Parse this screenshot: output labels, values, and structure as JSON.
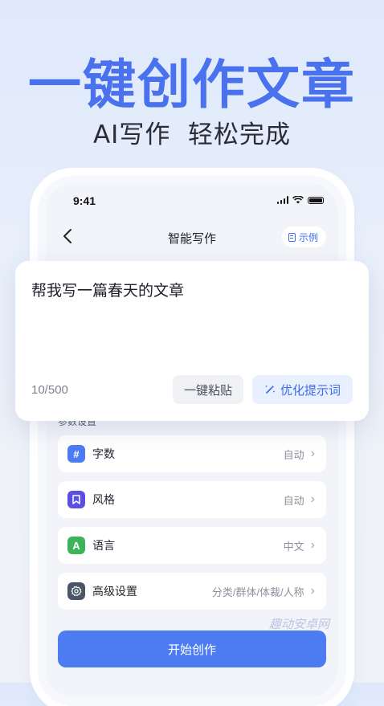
{
  "hero": {
    "title": "一键创作文章",
    "subtitle": "AI写作  轻松完成"
  },
  "status_bar": {
    "time": "9:41"
  },
  "nav": {
    "title": "智能写作",
    "example_label": "示例"
  },
  "editor": {
    "prompt": "帮我写一篇春天的文章",
    "char_count": "10/500",
    "paste_label": "一键粘贴",
    "optimize_label": "优化提示词"
  },
  "params": {
    "heading": "参数设置",
    "rows": [
      {
        "label": "字数",
        "value": "自动",
        "icon": "hash-icon",
        "icon_glyph": "#",
        "color": "#4d7cf2"
      },
      {
        "label": "风格",
        "value": "自动",
        "icon": "bookmark-icon",
        "icon_glyph": "",
        "color": "#5a4fe0"
      },
      {
        "label": "语言",
        "value": "中文",
        "icon": "language-icon",
        "icon_glyph": "A",
        "color": "#3fb35c"
      },
      {
        "label": "高级设置",
        "value": "分类/群体/体裁/人称",
        "icon": "gear-icon",
        "icon_glyph": "⚙",
        "color": "#4b5568"
      }
    ]
  },
  "start_button": {
    "label": "开始创作"
  },
  "watermark": "趣动安卓网"
}
